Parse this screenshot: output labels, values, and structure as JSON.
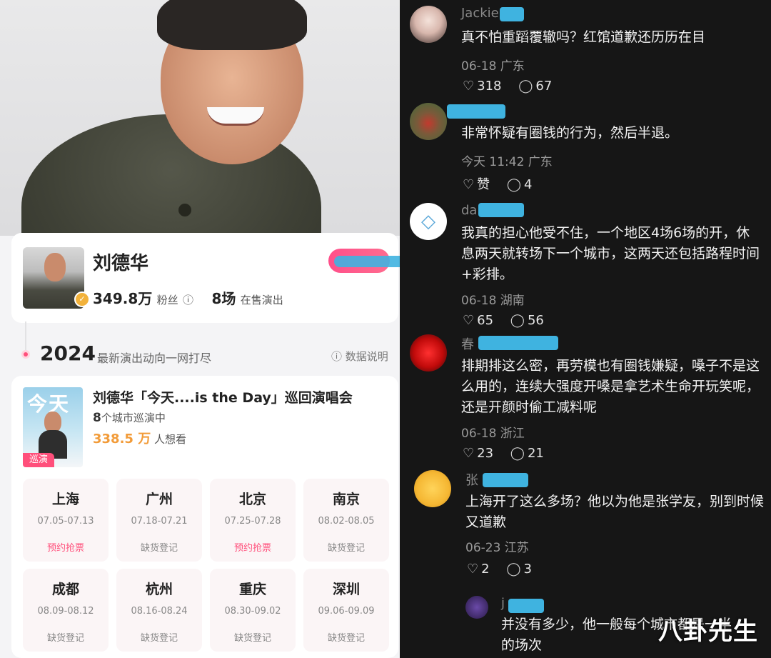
{
  "artist": {
    "name": "刘德华",
    "fans_value": "349.8万",
    "fans_label": "粉丝",
    "info_icon": "ⓘ",
    "shows_value": "8场",
    "shows_label": "在售演出",
    "verified_icon": "✓"
  },
  "timeline": {
    "year": "2024",
    "subtitle": "最新演出动向一网打尽",
    "info_label": "ⓘ 数据说明"
  },
  "tour": {
    "poster_text": "今天",
    "tag": "巡演",
    "title": "刘德华「今天....is the Day」巡回演唱会",
    "cities_num": "8",
    "cities_label": "个城市巡演中",
    "want_num": "338.5 万",
    "want_label": "人想看",
    "stops": [
      {
        "city": "上海",
        "dates": "07.05-07.13",
        "status": "预约抢票",
        "hot": true
      },
      {
        "city": "广州",
        "dates": "07.18-07.21",
        "status": "缺货登记",
        "hot": false
      },
      {
        "city": "北京",
        "dates": "07.25-07.28",
        "status": "预约抢票",
        "hot": true
      },
      {
        "city": "南京",
        "dates": "08.02-08.05",
        "status": "缺货登记",
        "hot": false
      },
      {
        "city": "成都",
        "dates": "08.09-08.12",
        "status": "缺货登记",
        "hot": false
      },
      {
        "city": "杭州",
        "dates": "08.16-08.24",
        "status": "缺货登记",
        "hot": false
      },
      {
        "city": "重庆",
        "dates": "08.30-09.02",
        "status": "缺货登记",
        "hot": false
      },
      {
        "city": "深圳",
        "dates": "09.06-09.09",
        "status": "缺货登记",
        "hot": false
      }
    ]
  },
  "comments": [
    {
      "user": "Jackie",
      "text": "真不怕重蹈覆辙吗？红馆道歉还历历在目",
      "meta": "06-18 广东",
      "likes": "318",
      "replies": "67"
    },
    {
      "user": "",
      "text": "非常怀疑有圈钱的行为，然后半退。",
      "meta": "今天 11:42 广东",
      "likes": "赞",
      "replies": "4"
    },
    {
      "user": "da",
      "text": "我真的担心他受不住，一个地区4场6场的开，休息两天就转场下一个城市，这两天还包括路程时间+彩排。",
      "meta": "06-18 湖南",
      "likes": "65",
      "replies": "56"
    },
    {
      "user": "春",
      "text": "排期排这么密，再劳模也有圈钱嫌疑，嗓子不是这么用的，连续大强度开嗓是拿艺术生命开玩笑呢，还是开颜时偷工减料呢",
      "meta": "06-18 浙江",
      "likes": "23",
      "replies": "21"
    },
    {
      "user": "张",
      "text": "上海开了这么多场？他以为他是张学友，别到时候又道歉",
      "meta": "06-23 江苏",
      "likes": "2",
      "replies": "3"
    },
    {
      "user": "j",
      "text": "并没有多少，他一般每个城市都是一半的场次",
      "meta": "",
      "likes": "",
      "replies": ""
    }
  ],
  "icons": {
    "like": "heart-icon",
    "reply": "comment-bubble-icon"
  },
  "watermark": "八卦先生",
  "colors": {
    "accent": "#ff4f7b",
    "want_orange": "#f29b38",
    "dark_bg": "#161616"
  }
}
